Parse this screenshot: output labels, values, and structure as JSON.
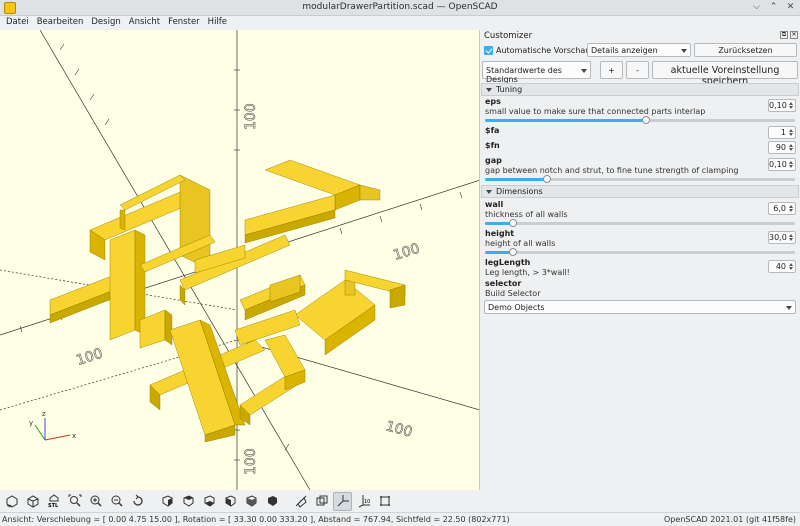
{
  "window": {
    "title": "modularDrawerPartition.scad — OpenSCAD"
  },
  "menus": [
    "Datei",
    "Bearbeiten",
    "Design",
    "Ansicht",
    "Fenster",
    "Hilfe"
  ],
  "axis_labels": {
    "x": "x",
    "y": "y",
    "z": "z"
  },
  "customizer": {
    "title": "Customizer",
    "auto_preview_label": "Automatische Vorschau",
    "auto_preview_checked": true,
    "details_select": "Details anzeigen",
    "reset_button": "Zurücksetzen",
    "preset_select": "Standardwerte des Designs",
    "plus_button": "+",
    "minus_button": "-",
    "save_preset_button": "aktuelle Voreinstellung speichern",
    "groups": [
      {
        "name": "Tuning",
        "params": [
          {
            "name": "eps",
            "description": "small value to make sure that connected parts interlap",
            "value": "0,10",
            "slider": 0.52
          },
          {
            "name": "$fa",
            "description": "",
            "value": "1"
          },
          {
            "name": "$fn",
            "description": "",
            "value": "90"
          },
          {
            "name": "gap",
            "description": "gap between notch and strut, to fine tune strength of clamping",
            "value": "0,10",
            "slider": 0.2
          }
        ]
      },
      {
        "name": "Dimensions",
        "params": [
          {
            "name": "wall",
            "description": "thickness of all walls",
            "value": "6,0",
            "slider": 0.09
          },
          {
            "name": "height",
            "description": "height of all walls",
            "value": "30,0",
            "slider": 0.09
          },
          {
            "name": "legLength",
            "description": "Leg length, > 3*wall!",
            "value": "40"
          },
          {
            "name": "selector",
            "description": "Build Selector",
            "select": "Demo Objects"
          }
        ]
      }
    ]
  },
  "status": {
    "left": "Ansicht: Verschiebung = [ 0.00 4.75 15.00 ], Rotation = [ 33.30 0.00 333.20 ], Abstand = 767.94, Sichtfeld = 22.50 (802x771)",
    "right": "OpenSCAD 2021.01 (git 41f58fe)"
  },
  "toolbar_icons": [
    "preview-icon",
    "render-icon",
    "export-stl-icon",
    "view-all-icon",
    "zoom-in-icon",
    "zoom-out-icon",
    "reset-view-icon",
    "view-right-icon",
    "view-top-icon",
    "view-bottom-icon",
    "view-left-icon",
    "view-front-icon",
    "view-back-icon",
    "diagonal-view-icon",
    "center-view-icon",
    "perspective-icon",
    "orthogonal-icon",
    "show-axes-icon",
    "show-scale-markers-icon",
    "show-edges-icon"
  ],
  "colors": {
    "model": "#f7d430",
    "model_dark": "#d9b400",
    "model_side": "#e8c520",
    "viewport_bg": "#ffffe5",
    "accent": "#3daee9"
  }
}
